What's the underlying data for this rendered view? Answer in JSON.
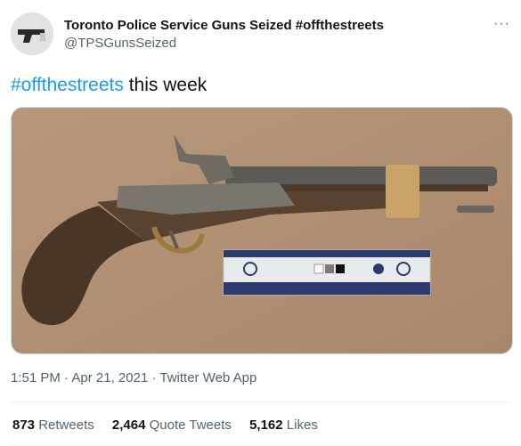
{
  "account": {
    "name": "Toronto Police Service Guns Seized #offthestreets",
    "handle": "@TPSGunsSeized"
  },
  "more_label": "···",
  "tweet": {
    "hashtag": "#offthestreets",
    "rest": " this week"
  },
  "meta": {
    "time": "1:51 PM",
    "sep1": " · ",
    "date": "Apr 21, 2021",
    "sep2": " · ",
    "app": "Twitter Web App"
  },
  "stats": {
    "retweets_count": "873",
    "retweets_label": "Retweets",
    "quotes_count": "2,464",
    "quotes_label": "Quote Tweets",
    "likes_count": "5,162",
    "likes_label": "Likes"
  }
}
